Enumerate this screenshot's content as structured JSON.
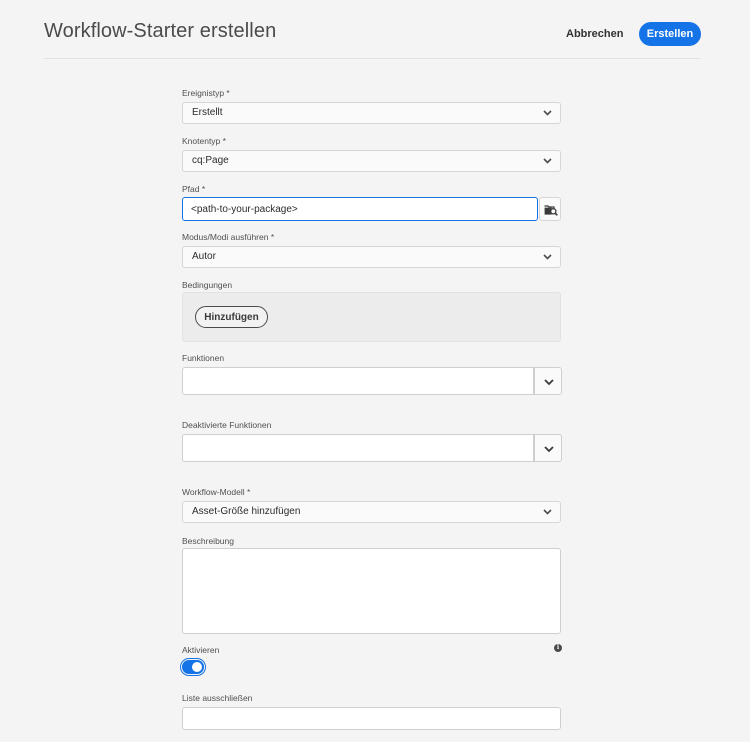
{
  "header": {
    "title": "Workflow-Starter erstellen",
    "cancel_label": "Abbrechen",
    "create_label": "Erstellen"
  },
  "form": {
    "event_type": {
      "label": "Ereignistyp *",
      "value": "Erstellt"
    },
    "node_type": {
      "label": "Knotentyp *",
      "value": "cq:Page"
    },
    "path": {
      "label": "Pfad *",
      "value": "<path-to-your-package>"
    },
    "run_modes": {
      "label": "Modus/Modi ausführen *",
      "value": "Autor"
    },
    "conditions": {
      "label": "Bedingungen",
      "add_label": "Hinzufügen"
    },
    "features": {
      "label": "Funktionen",
      "value": ""
    },
    "disabled_features": {
      "label": "Deaktivierte Funktionen",
      "value": ""
    },
    "workflow_model": {
      "label": "Workflow-Modell *",
      "value": "Asset-Größe hinzufügen"
    },
    "description": {
      "label": "Beschreibung",
      "value": ""
    },
    "activate": {
      "label": "Aktivieren",
      "checked": true
    },
    "exclude_list": {
      "label": "Liste ausschließen",
      "value": ""
    }
  },
  "icons": {
    "select_arrow": "chevron-down-icon",
    "path_browse": "folder-search-icon",
    "help": "info-icon"
  },
  "colors": {
    "accent": "#1473e6",
    "background": "#f4f4f4"
  }
}
